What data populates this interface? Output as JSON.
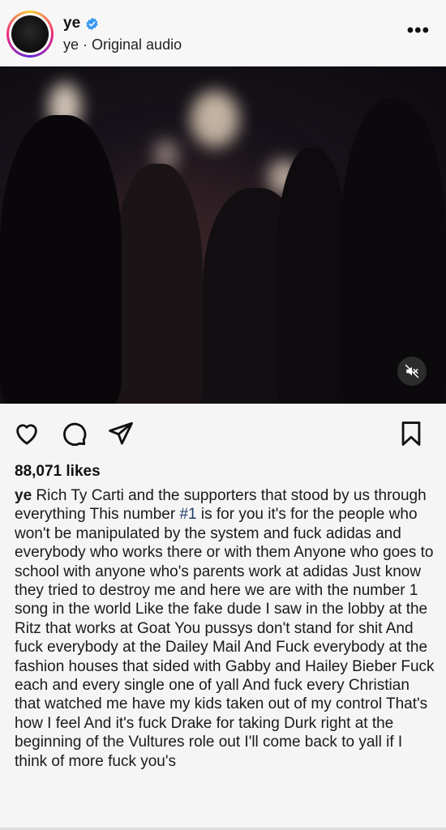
{
  "header": {
    "username": "ye",
    "audio_owner": "ye",
    "separator": "·",
    "audio_label": "Original audio",
    "more_label": "•••"
  },
  "icons": {
    "verified": "verified-badge-icon",
    "mute": "sound-off-icon",
    "like": "heart-icon",
    "comment": "comment-icon",
    "share": "send-icon",
    "save": "bookmark-icon"
  },
  "colors": {
    "verified_blue": "#3897f0",
    "hashtag": "#1f3b6e"
  },
  "post": {
    "likes": "88,071 likes",
    "caption_user": "ye",
    "caption_part1": " Rich Ty Carti and the supporters that stood by us through everything  This number ",
    "caption_hashtag": "#1",
    "caption_part2": " is for you it's for the people who won't be manipulated by the system and fuck adidas and everybody who works there or with them  Anyone who goes to school with anyone who's parents work at adidas  Just know they tried to destroy me and here we are with the number 1 song in the world  Like the fake dude I saw in the lobby at the Ritz that works at Goat  You pussys don't stand for shit  And fuck everybody at the Dailey Mail  And Fuck everybody at the fashion houses that sided with Gabby and Hailey Bieber  Fuck each and every single one of yall  And fuck every Christian that watched me have my kids taken out of my control That's how I feel  And it's fuck Drake for taking Durk right at the beginning of the Vultures  role out  I'll come back to yall if I think of more fuck you's"
  }
}
